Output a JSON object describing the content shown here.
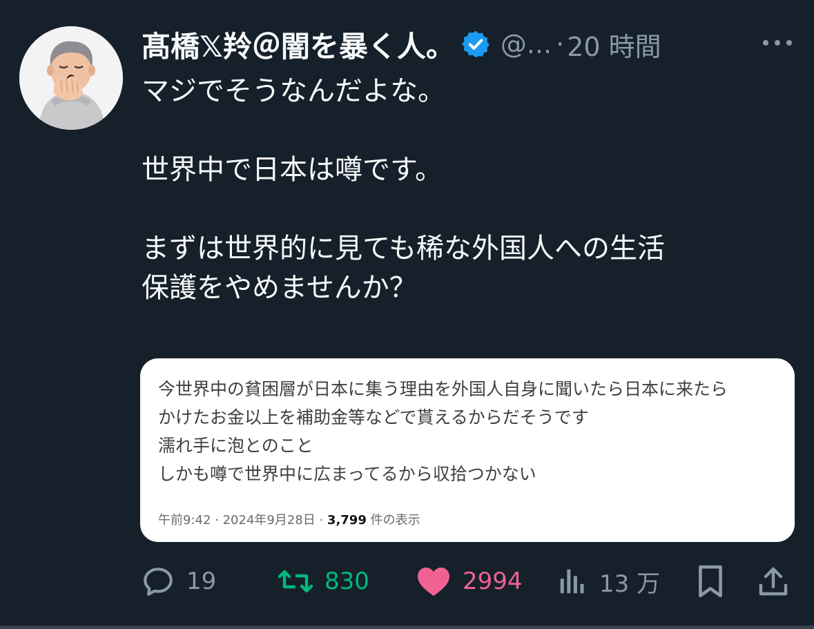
{
  "tweet": {
    "display_name": "髙橋𝕏羚＠闇を暴く人。",
    "handle": "@...",
    "separator": "·",
    "time": "20 時間",
    "text_lines": [
      "マジでそうなんだよな。",
      "",
      "世界中で日本は噂です。",
      "",
      "まずは世界的に見ても稀な外国人への生活",
      "保護をやめませんか？"
    ]
  },
  "quote": {
    "lines": [
      "今世界中の貧困層が日本に集う理由を外国人自身に聞いたら日本に来たら",
      "かけたお金以上を補助金等などで貰えるからだそうです",
      "濡れ手に泡とのこと",
      "しかも噂で世界中に広まってるから収拾つかない"
    ],
    "meta_prefix": "午前9:42 · 2024年9月28日 · ",
    "meta_views": "3,799",
    "meta_suffix": " 件の表示"
  },
  "actions": {
    "reply_count": "19",
    "retweet_count": "830",
    "like_count": "2994",
    "views_count": "13 万"
  },
  "icons": {
    "more": "more-horizontal-icon",
    "verified": "verified-badge-icon",
    "reply": "reply-icon",
    "retweet": "retweet-icon",
    "like": "heart-icon",
    "views": "analytics-icon",
    "bookmark": "bookmark-icon",
    "share": "share-icon"
  },
  "colors": {
    "background": "#15202b",
    "text": "#f7f9f9",
    "muted": "#8b98a5",
    "verified": "#1d9bf0",
    "retweet": "#00ba7c",
    "like": "#f91880",
    "quote_bg": "#ffffff"
  }
}
